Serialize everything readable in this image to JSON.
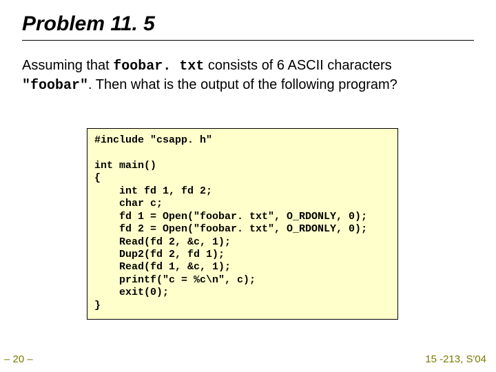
{
  "title": "Problem 11. 5",
  "prompt": {
    "p1": "Assuming that ",
    "mono1": "foobar. txt",
    "p2": " consists of 6 ASCII characters ",
    "mono2": "\"foobar\"",
    "p3": ". Then what is the output of the following program?"
  },
  "code": "#include \"csapp. h\"\n\nint main()\n{\n    int fd 1, fd 2;\n    char c;\n    fd 1 = Open(\"foobar. txt\", O_RDONLY, 0);\n    fd 2 = Open(\"foobar. txt\", O_RDONLY, 0);\n    Read(fd 2, &c, 1);\n    Dup2(fd 2, fd 1);\n    Read(fd 1, &c, 1);\n    printf(\"c = %c\\n\", c);\n    exit(0);\n}",
  "footer": {
    "page": "– 20 –",
    "course": "15 -213, S'04"
  }
}
